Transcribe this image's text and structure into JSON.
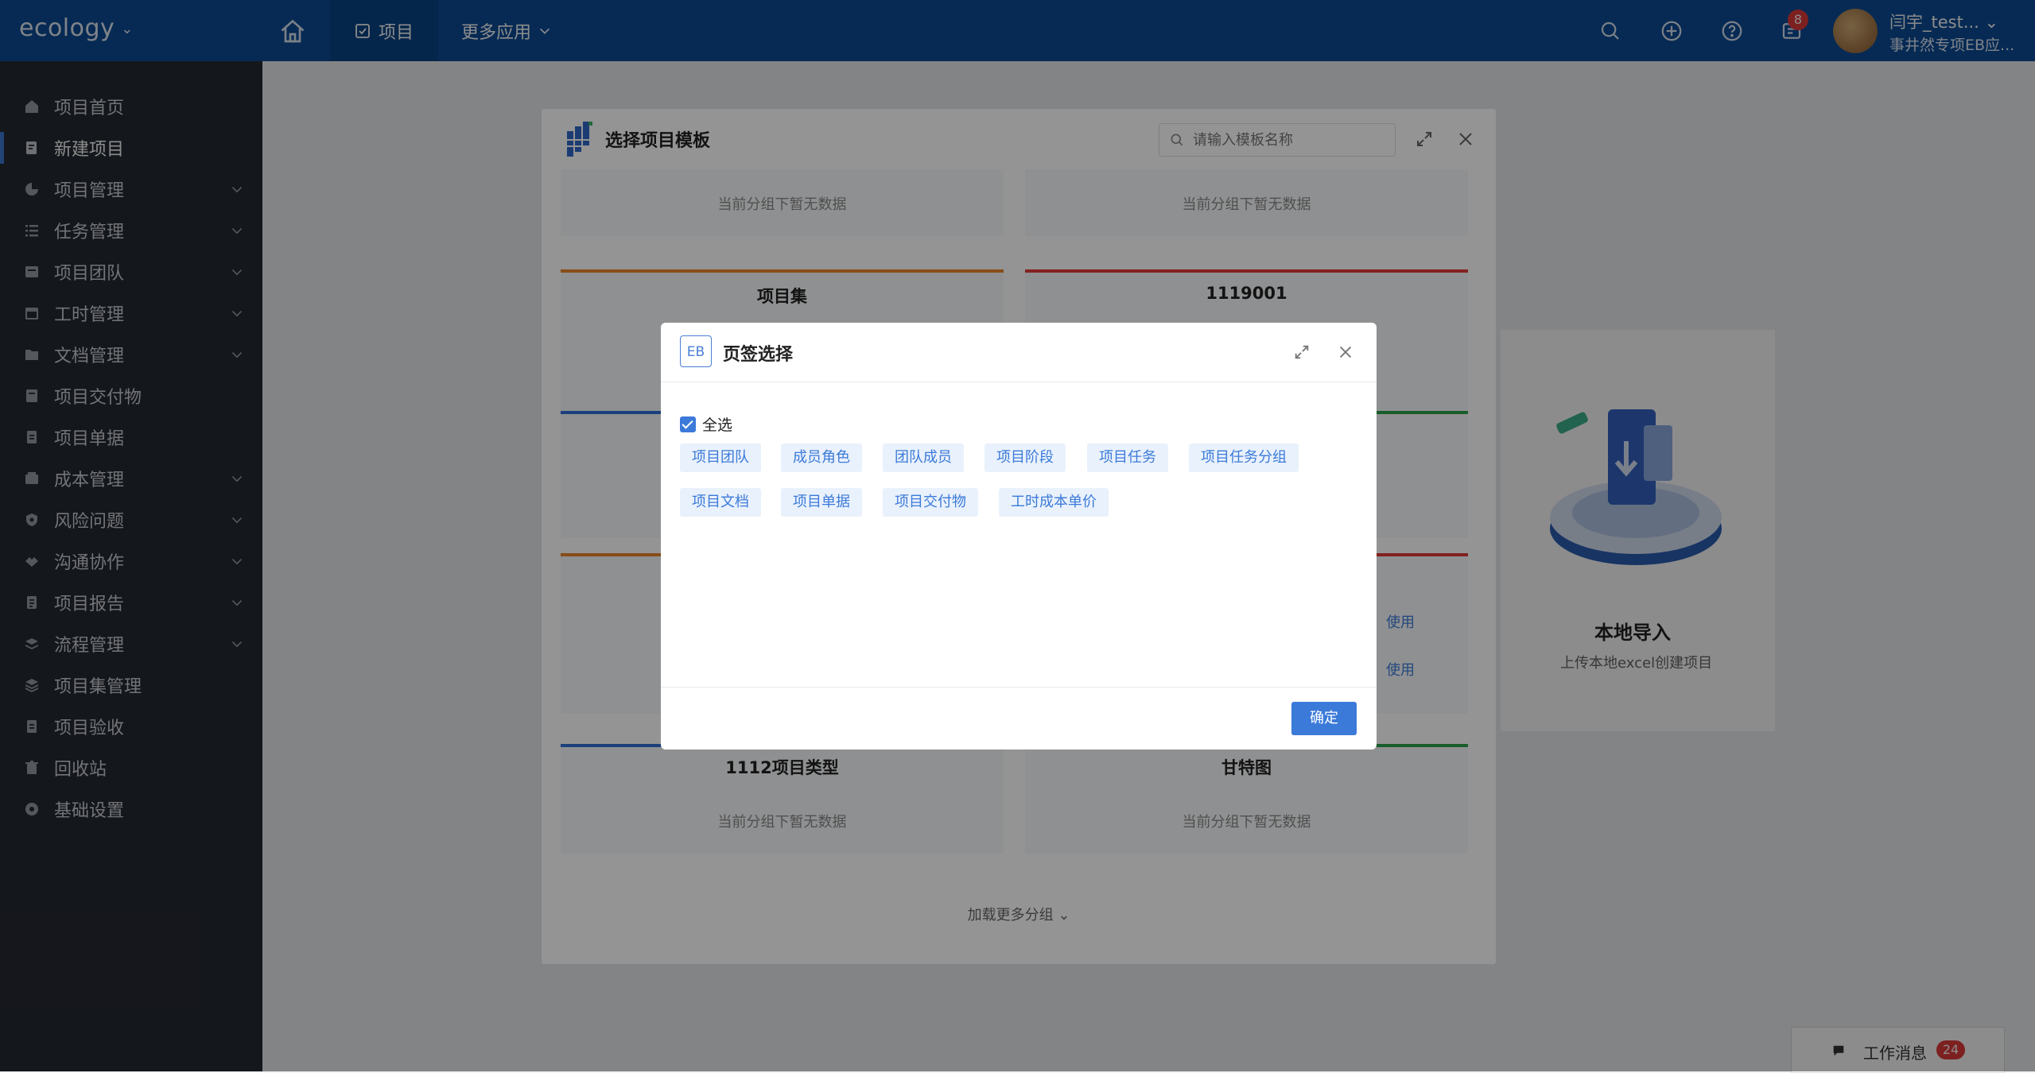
{
  "topbar": {
    "logo": "ecology",
    "tabs": [
      {
        "label": "项目"
      },
      {
        "label": "更多应用"
      }
    ],
    "notification_count": "8",
    "user_name": "闫宇_test...",
    "user_org": "事井然专项EB应..."
  },
  "sidebar": {
    "items": [
      {
        "label": "项目首页"
      },
      {
        "label": "新建项目"
      },
      {
        "label": "项目管理"
      },
      {
        "label": "任务管理"
      },
      {
        "label": "项目团队"
      },
      {
        "label": "工时管理"
      },
      {
        "label": "文档管理"
      },
      {
        "label": "项目交付物"
      },
      {
        "label": "项目单据"
      },
      {
        "label": "成本管理"
      },
      {
        "label": "风险问题"
      },
      {
        "label": "沟通协作"
      },
      {
        "label": "项目报告"
      },
      {
        "label": "流程管理"
      },
      {
        "label": "项目集管理"
      },
      {
        "label": "项目验收"
      },
      {
        "label": "回收站"
      },
      {
        "label": "基础设置"
      }
    ]
  },
  "background": {
    "import_title": "本地导入",
    "import_desc": "上传本地excel创建项目",
    "work_msg_label": "工作消息",
    "work_msg_count": "24"
  },
  "template_modal": {
    "title": "选择项目模板",
    "search_placeholder": "请输入模板名称",
    "empty_text": "当前分组下暂无数据",
    "cards": [
      {
        "name": "项目集"
      },
      {
        "name": "1119001"
      },
      {
        "name": "1112项目类型"
      },
      {
        "name": "甘特图"
      }
    ],
    "use_label": "使用",
    "load_more": "加载更多分组",
    "colors": {
      "orange": "#e8862a",
      "red": "#e03a3a",
      "blue": "#2f6fd6",
      "green": "#2aa04a"
    }
  },
  "tab_modal": {
    "icon_text": "EB",
    "title": "页签选择",
    "select_all": "全选",
    "tags": [
      "项目团队",
      "成员角色",
      "团队成员",
      "项目阶段",
      "项目任务",
      "项目任务分组",
      "项目文档",
      "项目单据",
      "项目交付物",
      "工时成本单价"
    ],
    "confirm": "确定"
  }
}
